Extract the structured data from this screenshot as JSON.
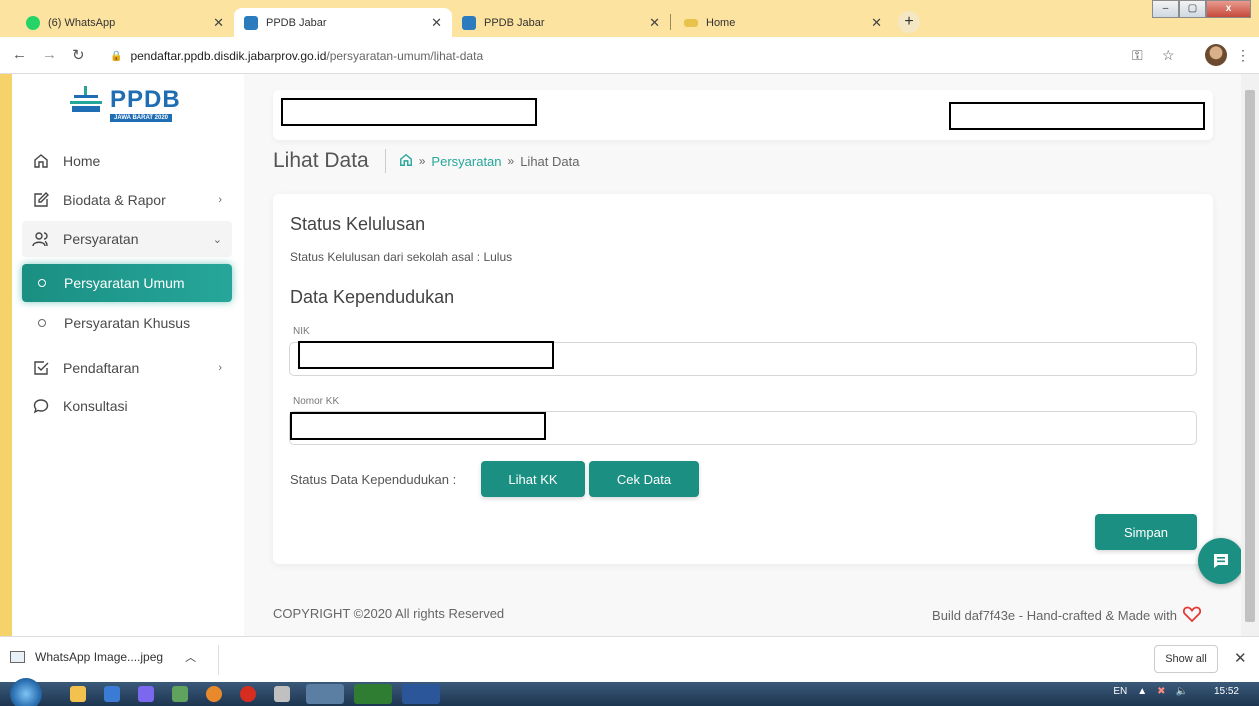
{
  "browser": {
    "tabs": [
      {
        "title": "(6) WhatsApp",
        "color": "#25d366",
        "active": false
      },
      {
        "title": "PPDB Jabar",
        "color": "#2b7bbf",
        "active": true
      },
      {
        "title": "PPDB Jabar",
        "color": "#2b7bbf",
        "active": false
      },
      {
        "title": "Home",
        "color": "#e8c24a",
        "active": false
      }
    ],
    "url_host": "pendaftar.ppdb.disdik.jabarprov.go.id",
    "url_path": "/persyaratan-umum/lihat-data"
  },
  "sidebar": {
    "logo_text": "PPDB",
    "logo_sub": "JAWA BARAT 2020",
    "items": [
      {
        "label": "Home",
        "icon": "home-icon"
      },
      {
        "label": "Biodata & Rapor",
        "icon": "edit-icon"
      },
      {
        "label": "Persyaratan",
        "icon": "users-icon"
      },
      {
        "label": "Persyaratan Umum",
        "icon": "circle-icon"
      },
      {
        "label": "Persyaratan Khusus",
        "icon": "circle-icon"
      },
      {
        "label": "Pendaftaran",
        "icon": "checkbox-icon"
      },
      {
        "label": "Konsultasi",
        "icon": "chat-bubble-icon"
      }
    ]
  },
  "breadcrumb": {
    "title": "Lihat Data",
    "link": "Persyaratan",
    "current": "Lihat Data",
    "separator": "»"
  },
  "card": {
    "status_heading": "Status Kelulusan",
    "status_line": "Status Kelulusan dari sekolah asal : Lulus",
    "kependudukan_heading": "Data Kependudukan",
    "nik_label": "NIK",
    "kk_label": "Nomor KK",
    "status_data_label": "Status Data Kependudukan :",
    "btn_lihat_kk": "Lihat KK",
    "btn_cek_data": "Cek Data",
    "btn_simpan": "Simpan"
  },
  "footer": {
    "copyright": "COPYRIGHT ©2020 All rights Reserved",
    "build": "Build daf7f43e - Hand-crafted & Made with"
  },
  "downloads": {
    "file": "WhatsApp Image....jpeg",
    "show_all": "Show all"
  },
  "taskbar": {
    "lang": "EN",
    "time": "15:52"
  },
  "colors": {
    "accent": "#1a8f82",
    "link": "#26a69a",
    "brand": "#1f6db3"
  }
}
